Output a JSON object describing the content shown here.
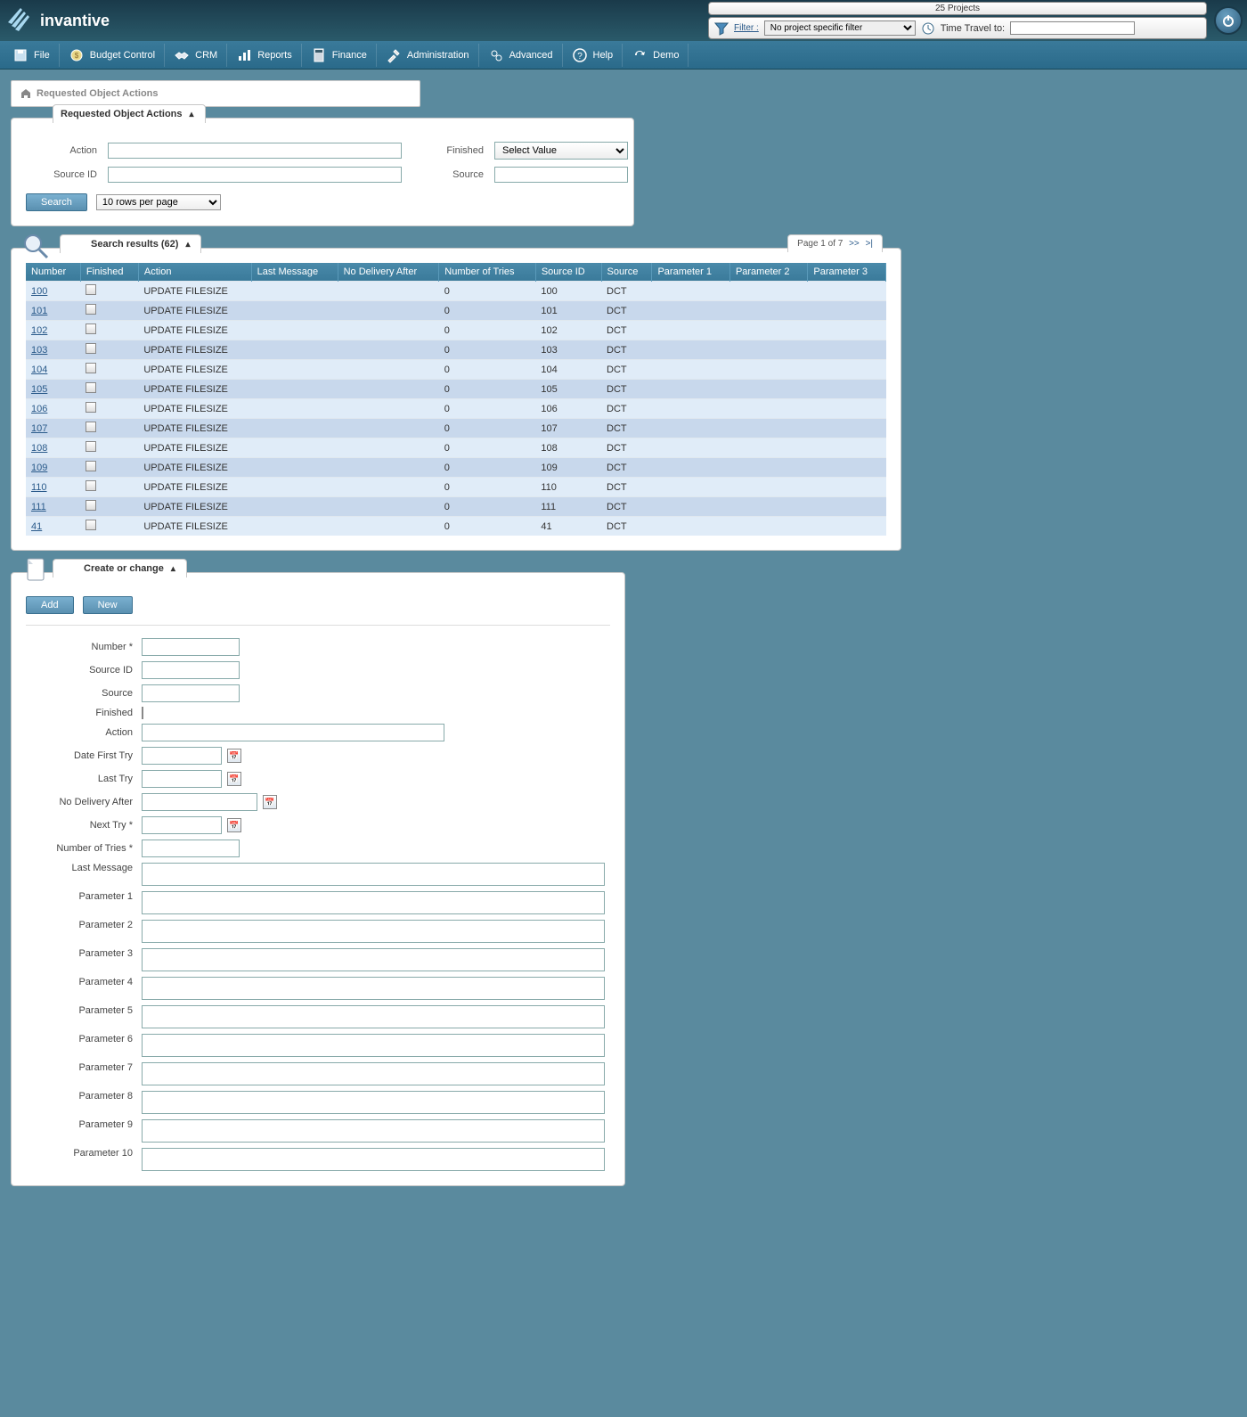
{
  "header": {
    "brand": "invantive",
    "projects_label": "25 Projects",
    "filter_label": "Filter :",
    "filter_value": "No project specific filter",
    "time_travel_label": "Time Travel to:"
  },
  "menu": [
    {
      "label": "File",
      "icon": "disk"
    },
    {
      "label": "Budget Control",
      "icon": "money"
    },
    {
      "label": "CRM",
      "icon": "handshake"
    },
    {
      "label": "Reports",
      "icon": "chart"
    },
    {
      "label": "Finance",
      "icon": "calc"
    },
    {
      "label": "Administration",
      "icon": "tools"
    },
    {
      "label": "Advanced",
      "icon": "gears"
    },
    {
      "label": "Help",
      "icon": "question"
    },
    {
      "label": "Demo",
      "icon": "refresh"
    }
  ],
  "breadcrumb": "Requested Object Actions",
  "search_panel": {
    "title": "Requested Object Actions",
    "labels": {
      "action": "Action",
      "finished": "Finished",
      "source_id": "Source ID",
      "source": "Source"
    },
    "finished_placeholder": "Select Value",
    "search_btn": "Search",
    "rows_per_page": "10 rows per page"
  },
  "results_panel": {
    "title": "Search results (62)",
    "pager": {
      "text": "Page 1 of 7",
      "next": ">>",
      "last": ">|"
    },
    "columns": [
      "Number",
      "Finished",
      "Action",
      "Last Message",
      "No Delivery After",
      "Number of Tries",
      "Source ID",
      "Source",
      "Parameter 1",
      "Parameter 2",
      "Parameter 3"
    ],
    "rows": [
      {
        "number": "100",
        "action": "UPDATE FILESIZE",
        "tries": "0",
        "source_id": "100",
        "source": "DCT"
      },
      {
        "number": "101",
        "action": "UPDATE FILESIZE",
        "tries": "0",
        "source_id": "101",
        "source": "DCT"
      },
      {
        "number": "102",
        "action": "UPDATE FILESIZE",
        "tries": "0",
        "source_id": "102",
        "source": "DCT"
      },
      {
        "number": "103",
        "action": "UPDATE FILESIZE",
        "tries": "0",
        "source_id": "103",
        "source": "DCT"
      },
      {
        "number": "104",
        "action": "UPDATE FILESIZE",
        "tries": "0",
        "source_id": "104",
        "source": "DCT"
      },
      {
        "number": "105",
        "action": "UPDATE FILESIZE",
        "tries": "0",
        "source_id": "105",
        "source": "DCT"
      },
      {
        "number": "106",
        "action": "UPDATE FILESIZE",
        "tries": "0",
        "source_id": "106",
        "source": "DCT"
      },
      {
        "number": "107",
        "action": "UPDATE FILESIZE",
        "tries": "0",
        "source_id": "107",
        "source": "DCT"
      },
      {
        "number": "108",
        "action": "UPDATE FILESIZE",
        "tries": "0",
        "source_id": "108",
        "source": "DCT"
      },
      {
        "number": "109",
        "action": "UPDATE FILESIZE",
        "tries": "0",
        "source_id": "109",
        "source": "DCT"
      },
      {
        "number": "110",
        "action": "UPDATE FILESIZE",
        "tries": "0",
        "source_id": "110",
        "source": "DCT"
      },
      {
        "number": "111",
        "action": "UPDATE FILESIZE",
        "tries": "0",
        "source_id": "111",
        "source": "DCT"
      },
      {
        "number": "41",
        "action": "UPDATE FILESIZE",
        "tries": "0",
        "source_id": "41",
        "source": "DCT"
      }
    ]
  },
  "create_panel": {
    "title": "Create or change",
    "add_btn": "Add",
    "new_btn": "New",
    "labels": {
      "number": "Number *",
      "source_id": "Source ID",
      "source": "Source",
      "finished": "Finished",
      "action": "Action",
      "date_first_try": "Date First Try",
      "last_try": "Last Try",
      "no_delivery_after": "No Delivery After",
      "next_try": "Next Try *",
      "number_of_tries": "Number of Tries *",
      "last_message": "Last Message",
      "parameter_1": "Parameter 1",
      "parameter_2": "Parameter 2",
      "parameter_3": "Parameter 3",
      "parameter_4": "Parameter 4",
      "parameter_5": "Parameter 5",
      "parameter_6": "Parameter 6",
      "parameter_7": "Parameter 7",
      "parameter_8": "Parameter 8",
      "parameter_9": "Parameter 9",
      "parameter_10": "Parameter 10"
    }
  }
}
